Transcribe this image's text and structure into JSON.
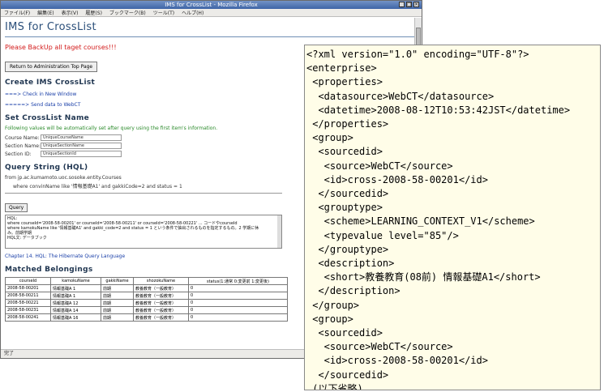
{
  "browser": {
    "title": "IMS for CrossList - Mozilla Firefox",
    "menu": [
      "ファイル(F)",
      "編集(E)",
      "表示(V)",
      "履歴(S)",
      "ブックマーク(B)",
      "ツール(T)",
      "ヘルプ(H)"
    ],
    "status": "完了"
  },
  "page": {
    "app_title": "IMS for CrossList",
    "warning": "Please BackUp all taget courses!!!",
    "return_button": "Return to Administration Top Page",
    "create_heading": "Create IMS CrossList",
    "check_link": "===> Check in New Window",
    "send_link": "=====> Send data to WebCT",
    "set_heading": "Set CrossList Name",
    "info": "Following values will be automatically set after query using the first item's information.",
    "fields": [
      {
        "label": "Course Name:",
        "value": "UniqueCourseName"
      },
      {
        "label": "Section Name:",
        "value": "UniqueSectionName"
      },
      {
        "label": "Section ID:",
        "value": "UniqueSectionId"
      }
    ],
    "query_heading": "Query String (HQL)",
    "from_line": "from jp.ac.kumamoto.uoc.sosoke.entity.Courses",
    "where_line": "where convinName like '情報基礎A1' and gakkiCode=2 and status = 1",
    "query_button": "Query",
    "hql_lines": [
      "HQL:",
      "where courseId='2008-58-00201' or courseId='2008-58-00211' or courseId='2008-58-00221' ... コードやcourseId",
      "where kamokuName like '情報基礎A1' and gakki_code=2 and status = 1 という条件で抽出されるものを指定するもの。2 学期に休",
      "み。前期学期",
      "HQL文: データブック"
    ],
    "ref_link": "Chapter 14. HQL: The Hibernate Query Language",
    "matched_heading": "Matched Belongings",
    "table": {
      "headers": [
        "courseId",
        "kamokuName",
        "gakkiName",
        "shozokuName",
        "status(1:通常 0:変更前 1:変更後)"
      ],
      "rows": [
        [
          "2008-58-00201",
          "情報基礎A 1",
          "前期",
          "教養教育（一般教育）",
          "0"
        ],
        [
          "2008-58-00211",
          "情報基礎A 1",
          "前期",
          "教養教育（一般教育）",
          "0"
        ],
        [
          "2008-58-00221",
          "情報基礎A 12",
          "前期",
          "教養教育（一般教育）",
          "0"
        ],
        [
          "2008-58-00231",
          "情報基礎A 14",
          "前期",
          "教養教育（一般教育）",
          "0"
        ],
        [
          "2008-58-00241",
          "情報基礎A 16",
          "前期",
          "教養教育（一般教育）",
          "0"
        ]
      ]
    }
  },
  "xml": {
    "lines": [
      "<?xml version=\"1.0\" encoding=\"UTF-8\"?>",
      "<enterprise>",
      " <properties>",
      "  <datasource>WebCT</datasource>",
      "  <datetime>2008-08-12T10:53:42JST</datetime>",
      " </properties>",
      " <group>",
      "  <sourcedid>",
      "   <source>WebCT</source>",
      "   <id>cross-2008-58-00201</id>",
      "  </sourcedid>",
      "  <grouptype>",
      "   <scheme>LEARNING_CONTEXT_V1</scheme>",
      "   <typevalue level=\"85\"/>",
      "  </grouptype>",
      "  <description>",
      "   <short>教養教育(08前) 情報基礎A1</short>",
      "  </description>",
      " </group>",
      " <group>",
      "  <sourcedid>",
      "   <source>WebCT</source>",
      "   <id>cross-2008-58-00201</id>",
      "  </sourcedid>",
      " (以下省略)"
    ]
  }
}
